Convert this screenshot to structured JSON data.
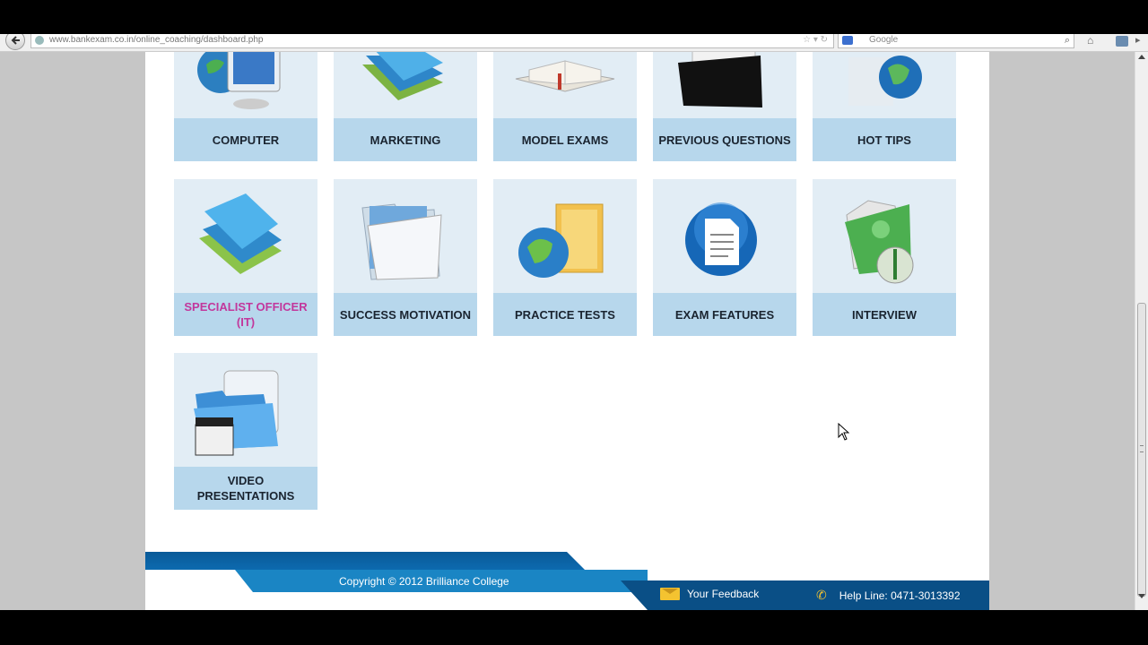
{
  "browser": {
    "url": "www.bankexam.co.in/online_coaching/dashboard.php",
    "search_placeholder": "Google"
  },
  "tiles": [
    {
      "label": "COMPUTER",
      "icon": "computer-monitor-icon"
    },
    {
      "label": "MARKETING",
      "icon": "books-icon"
    },
    {
      "label": "MODEL EXAMS",
      "icon": "open-book-icon"
    },
    {
      "label": "PREVIOUS QUESTIONS",
      "icon": "black-folder-icon"
    },
    {
      "label": "HOT TIPS",
      "icon": "globe-icon"
    },
    {
      "label": "SPECIALIST OFFICER (IT)",
      "icon": "blue-books-icon",
      "color": "#c2379c"
    },
    {
      "label": "SUCCESS MOTIVATION",
      "icon": "white-folder-icon"
    },
    {
      "label": "PRACTICE TESTS",
      "icon": "globe-folder-icon"
    },
    {
      "label": "EXAM FEATURES",
      "icon": "document-orb-icon"
    },
    {
      "label": "INTERVIEW",
      "icon": "user-folder-icon"
    },
    {
      "label": "VIDEO PRESENTATIONS",
      "icon": "video-folder-icon"
    }
  ],
  "footer": {
    "copyright": "Copyright © 2012 Brilliance College",
    "feedback": "Your Feedback",
    "helpline": "Help Line: 0471-3013392"
  },
  "colors": {
    "tile_label_bg": "#b7d7ec",
    "tile_bg": "#e2edf5",
    "footer_blue": "#0a5a98",
    "accent_pink": "#c2379c"
  }
}
